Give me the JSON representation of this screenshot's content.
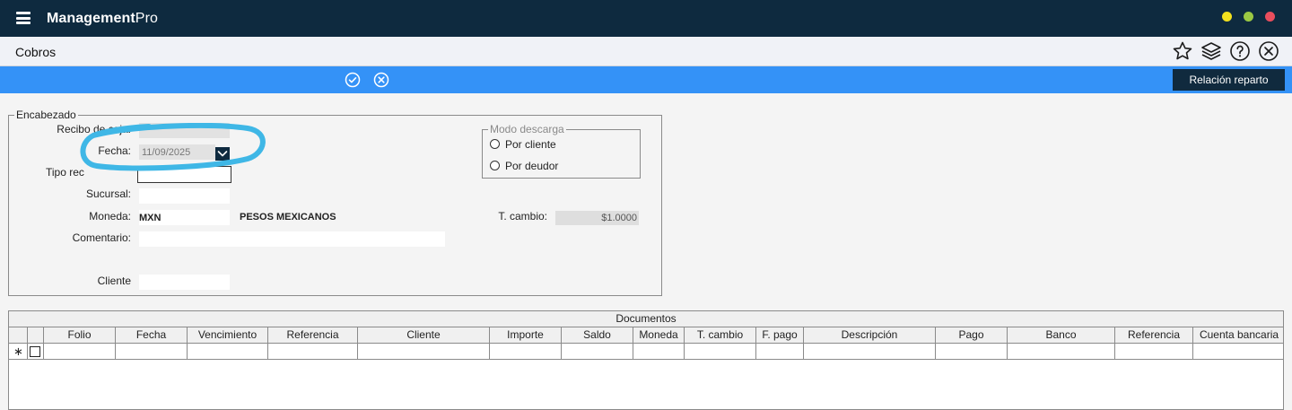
{
  "app": {
    "brand_main": "Management",
    "brand_sub": "Pro"
  },
  "colors": {
    "titlebar": "#0e2a3f",
    "actionbar": "#3492f7",
    "accent_dark": "#102a3e",
    "dot_yellow": "#f2e01e",
    "dot_green": "#9bc843",
    "dot_red": "#ea4e5d",
    "annotation": "#3fb7e6"
  },
  "module": {
    "title": "Cobros",
    "icons": [
      "star-icon",
      "layers-icon",
      "help-icon",
      "close-circle-icon"
    ]
  },
  "actions": {
    "confirm_icon": "check-circle-icon",
    "cancel_icon": "x-circle-icon",
    "relacion_label": "Relación reparto"
  },
  "encabezado": {
    "title": "Encabezado",
    "recibo_label": "Recibo de caja:",
    "recibo_value": "",
    "fecha_label": "Fecha:",
    "fecha_value": "11/09/2025",
    "tipo_label": "Tipo rec",
    "tipo_value": "",
    "sucursal_label": "Sucursal:",
    "sucursal_value": "",
    "moneda_label": "Moneda:",
    "moneda_code": "MXN",
    "moneda_name": "PESOS MEXICANOS",
    "comentario_label": "Comentario:",
    "comentario_value": "",
    "cliente_label": "Cliente",
    "cliente_value": "",
    "tcambio_label": "T. cambio:",
    "tcambio_value": "$1.0000",
    "modo": {
      "title": "Modo descarga",
      "opt1": "Por cliente",
      "opt2": "Por deudor"
    }
  },
  "documentos": {
    "title": "Documentos",
    "new_row_marker": "∗",
    "columns": [
      "Folio",
      "Fecha",
      "Vencimiento",
      "Referencia",
      "Cliente",
      "Importe",
      "Saldo",
      "Moneda",
      "T. cambio",
      "F. pago",
      "Descripción",
      "Pago",
      "Banco",
      "Referencia",
      "Cuenta bancaria"
    ]
  }
}
